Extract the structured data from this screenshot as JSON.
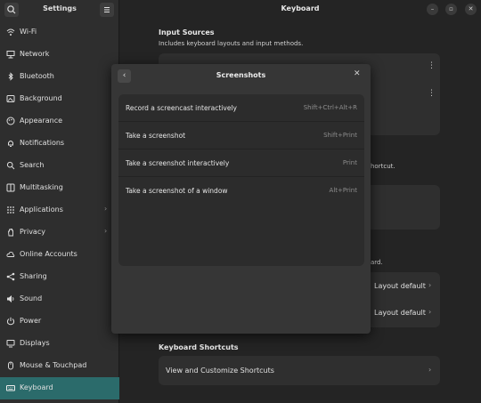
{
  "sidebar": {
    "title": "Settings",
    "items": [
      {
        "label": "Wi-Fi",
        "icon": "wifi-icon",
        "chevron": false
      },
      {
        "label": "Network",
        "icon": "network-icon",
        "chevron": false
      },
      {
        "label": "Bluetooth",
        "icon": "bluetooth-icon",
        "chevron": false
      },
      {
        "label": "Background",
        "icon": "background-icon",
        "chevron": false
      },
      {
        "label": "Appearance",
        "icon": "appearance-icon",
        "chevron": false
      },
      {
        "label": "Notifications",
        "icon": "bell-icon",
        "chevron": false
      },
      {
        "label": "Search",
        "icon": "search-icon",
        "chevron": false
      },
      {
        "label": "Multitasking",
        "icon": "multitasking-icon",
        "chevron": false
      },
      {
        "label": "Applications",
        "icon": "grid-icon",
        "chevron": true
      },
      {
        "label": "Privacy",
        "icon": "hand-icon",
        "chevron": true
      },
      {
        "label": "Online Accounts",
        "icon": "cloud-icon",
        "chevron": false
      },
      {
        "label": "Sharing",
        "icon": "share-icon",
        "chevron": false
      },
      {
        "label": "Sound",
        "icon": "sound-icon",
        "chevron": false
      },
      {
        "label": "Power",
        "icon": "power-icon",
        "chevron": false
      },
      {
        "label": "Displays",
        "icon": "display-icon",
        "chevron": false
      },
      {
        "label": "Mouse & Touchpad",
        "icon": "mouse-icon",
        "chevron": false
      },
      {
        "label": "Keyboard",
        "icon": "keyboard-icon",
        "chevron": false,
        "active": true
      }
    ]
  },
  "main": {
    "title": "Keyboard",
    "input_sources": {
      "title": "Input Sources",
      "subtitle": "Includes keyboard layouts and input methods."
    },
    "partial_text_1": "hortcut.",
    "partial_text_2": "ard.",
    "layout_rows": [
      {
        "value": "Layout default"
      },
      {
        "value": "Layout default"
      }
    ],
    "keyboard_shortcuts": {
      "title": "Keyboard Shortcuts",
      "row_label": "View and Customize Shortcuts"
    }
  },
  "dialog": {
    "title": "Screenshots",
    "rows": [
      {
        "label": "Record a screencast interactively",
        "accel": "Shift+Ctrl+Alt+R"
      },
      {
        "label": "Take a screenshot",
        "accel": "Shift+Print"
      },
      {
        "label": "Take a screenshot interactively",
        "accel": "Print"
      },
      {
        "label": "Take a screenshot of a window",
        "accel": "Alt+Print"
      }
    ]
  },
  "colors": {
    "accent": "#2b6b6b",
    "window_bg": "#242424",
    "sidebar_bg": "#2e2e2e",
    "dialog_bg": "#363636"
  }
}
